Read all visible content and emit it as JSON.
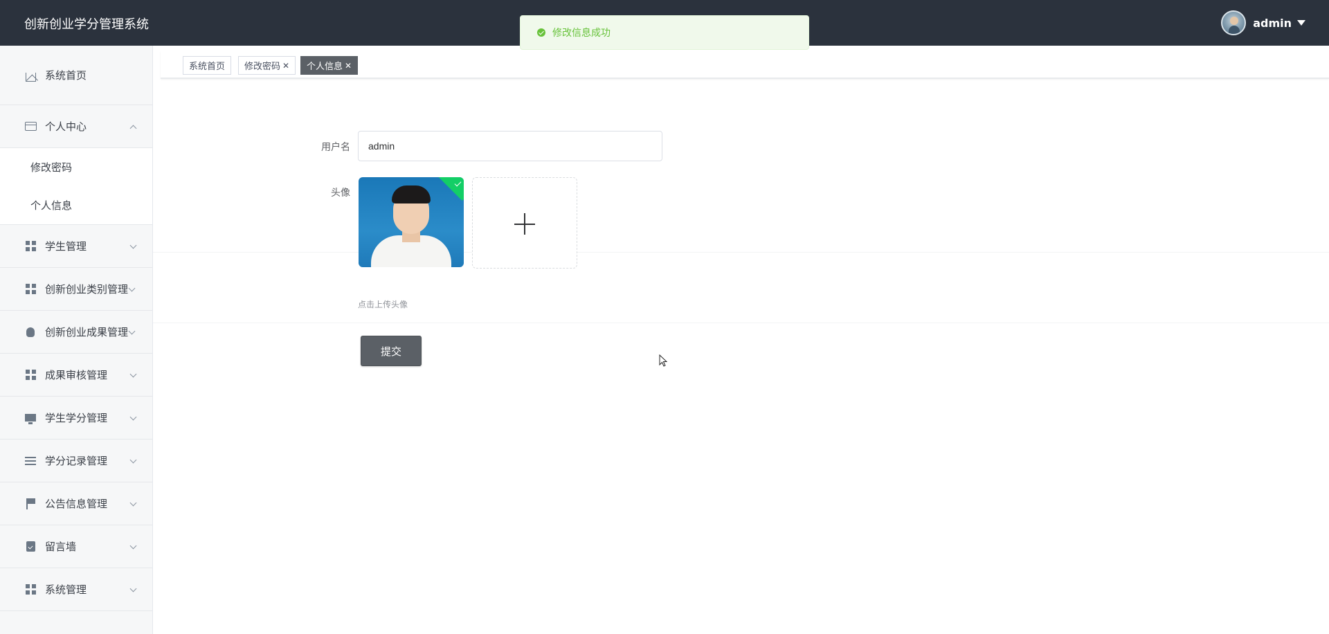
{
  "app": {
    "title": "创新创业学分管理系统"
  },
  "user": {
    "name": "admin"
  },
  "toast": {
    "message": "修改信息成功",
    "type": "success"
  },
  "sidebar": {
    "items": [
      {
        "label": "系统首页",
        "icon": "home-icon"
      },
      {
        "label": "个人中心",
        "icon": "card-icon",
        "expanded": true,
        "children": [
          {
            "label": "修改密码"
          },
          {
            "label": "个人信息"
          }
        ]
      },
      {
        "label": "学生管理",
        "icon": "grid-icon"
      },
      {
        "label": "创新创业类别管理",
        "icon": "grid-icon"
      },
      {
        "label": "创新创业成果管理",
        "icon": "bulb-icon"
      },
      {
        "label": "成果审核管理",
        "icon": "grid-icon"
      },
      {
        "label": "学生学分管理",
        "icon": "monitor-icon"
      },
      {
        "label": "学分记录管理",
        "icon": "lines-icon"
      },
      {
        "label": "公告信息管理",
        "icon": "flag-icon"
      },
      {
        "label": "留言墙",
        "icon": "clipboard-check-icon"
      },
      {
        "label": "系统管理",
        "icon": "grid-icon"
      }
    ]
  },
  "tabs": [
    {
      "label": "系统首页",
      "closable": false,
      "active": false
    },
    {
      "label": "修改密码",
      "closable": true,
      "active": false
    },
    {
      "label": "个人信息",
      "closable": true,
      "active": true
    }
  ],
  "form": {
    "username_label": "用户名",
    "username_value": "admin",
    "avatar_label": "头像",
    "upload_hint": "点击上传头像",
    "submit_label": "提交"
  },
  "colors": {
    "header_bg": "#2b323d",
    "success": "#67c23a",
    "active_tab": "#5b6066"
  }
}
